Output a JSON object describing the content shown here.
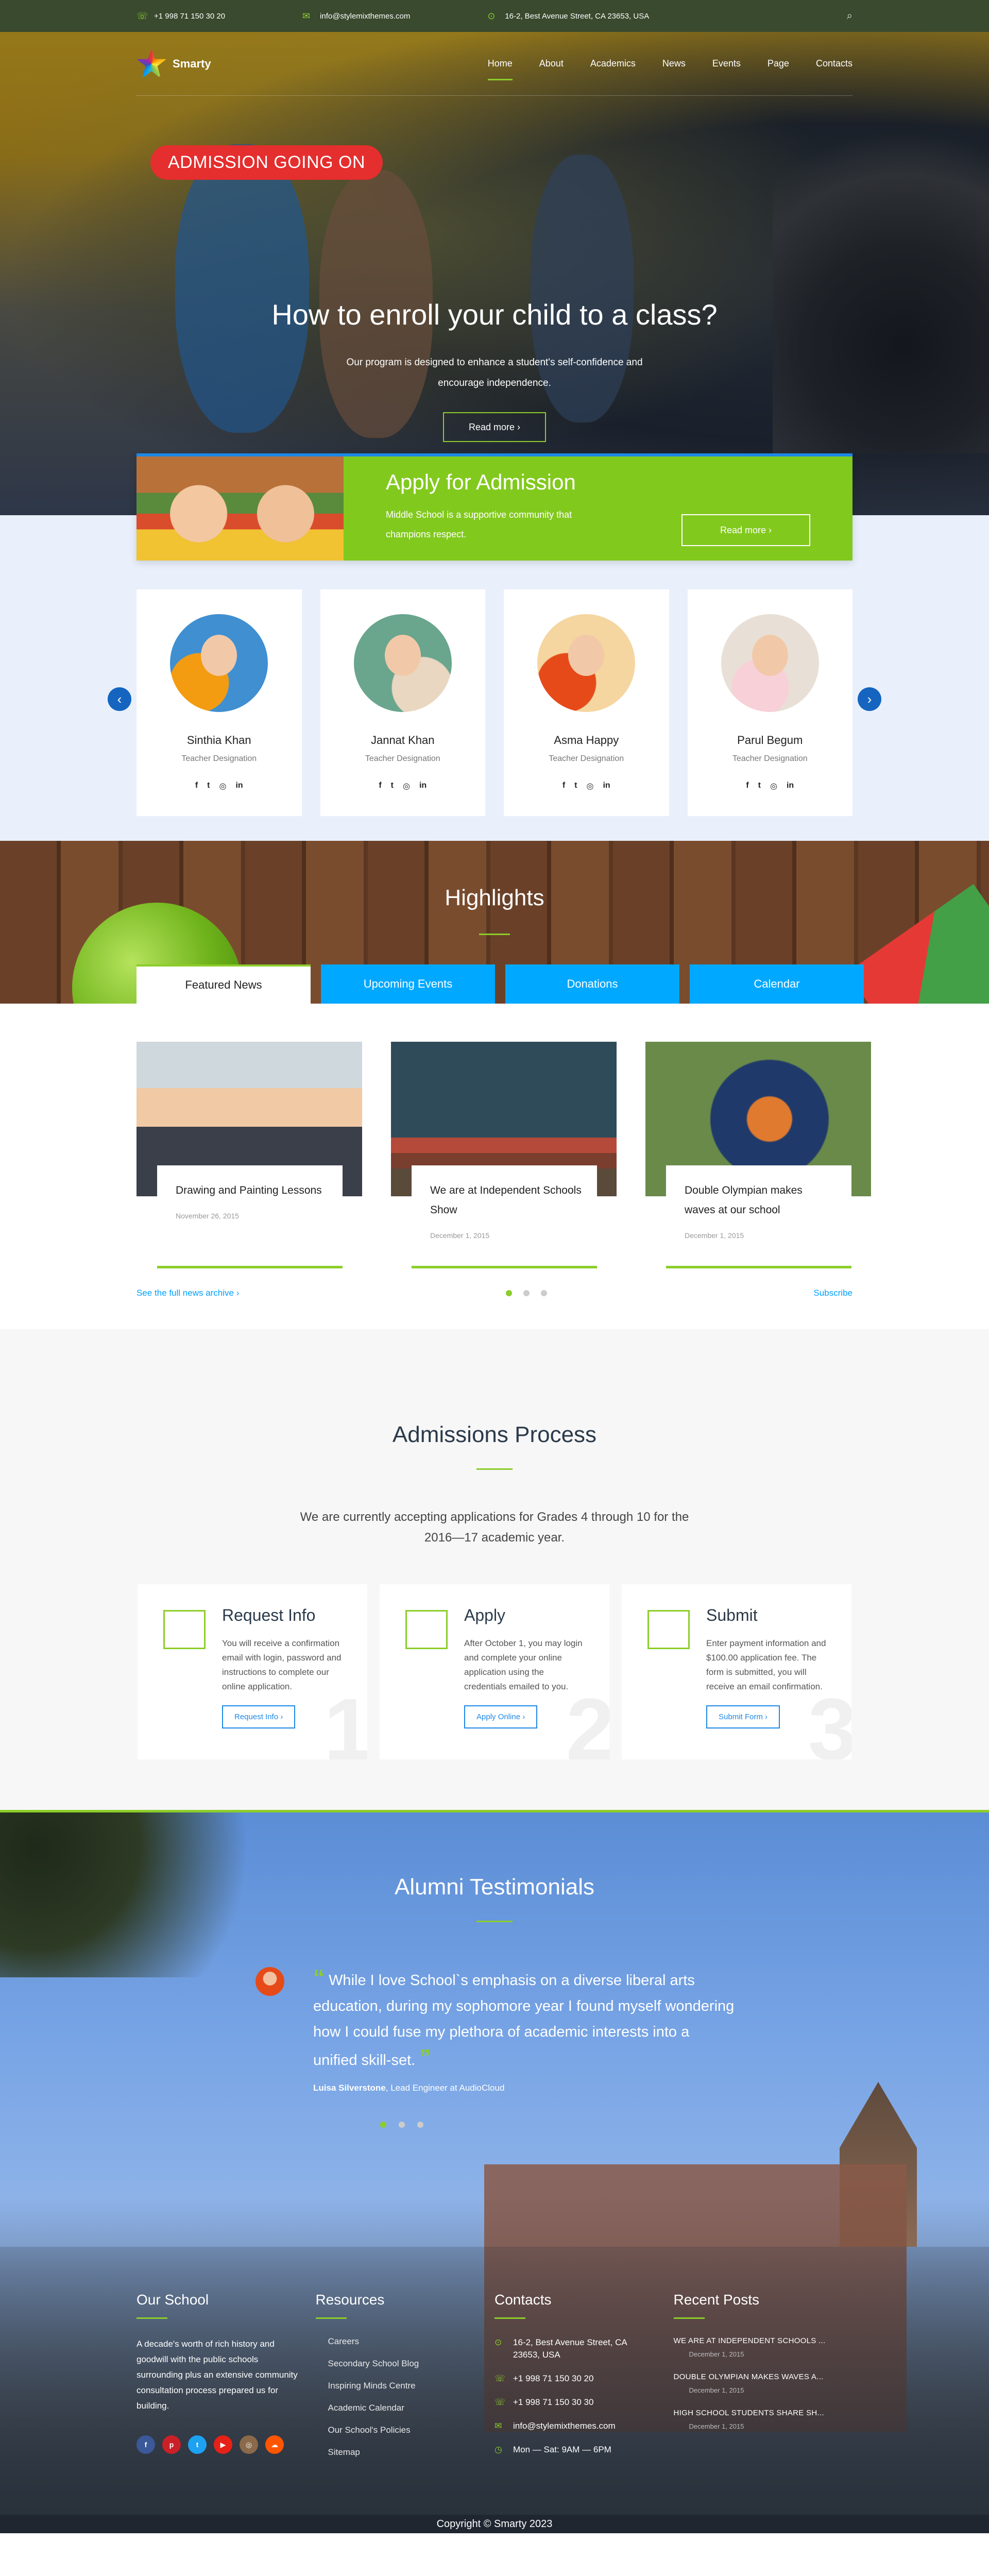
{
  "topbar": {
    "phone": "+1 998 71 150 30 20",
    "email": "info@stylemixthemes.com",
    "address": "16-2, Best Avenue Street, CA 23653, USA"
  },
  "nav": {
    "brand": "Smarty",
    "items": [
      "Home",
      "About",
      "Academics",
      "News",
      "Events",
      "Page",
      "Contacts"
    ]
  },
  "hero": {
    "badge": "ADMISSION GOING ON",
    "title": "How to enroll your child to a class?",
    "subtitle_line1": "Our program is designed to enhance a student's self-confidence and",
    "subtitle_line2": "encourage independence.",
    "button": "Read more ›"
  },
  "apply": {
    "title": "Apply for Admission",
    "text": "Middle School is a supportive community that champions respect.",
    "button": "Read more ›"
  },
  "teachers": [
    {
      "name": "Sinthia Khan",
      "designation": "Teacher Designation"
    },
    {
      "name": "Jannat Khan",
      "designation": "Teacher Designation"
    },
    {
      "name": "Asma Happy",
      "designation": "Teacher Designation"
    },
    {
      "name": "Parul Begum",
      "designation": "Teacher Designation"
    }
  ],
  "highlights": {
    "title": "Highlights",
    "tabs": [
      "Featured News",
      "Upcoming Events",
      "Donations",
      "Calendar"
    ],
    "news": [
      {
        "title": "Drawing and Painting Lessons",
        "date": "November 26, 2015"
      },
      {
        "title": "We are at Independent Schools Show",
        "date": "December 1, 2015"
      },
      {
        "title": "Double Olympian makes waves at our school",
        "date": "December 1, 2015"
      }
    ],
    "archive_link": "See the full news archive ›",
    "subscribe": "Subscribe"
  },
  "admissions": {
    "title": "Admissions Process",
    "intro": "We are currently accepting applications for Grades 4 through 10 for the 2016—17 academic year.",
    "steps": [
      {
        "title": "Request Info",
        "text": "You will receive a confirmation email with login, password and instructions to complete our online application.",
        "button": "Request Info ›",
        "num": "1"
      },
      {
        "title": "Apply",
        "text": "After October 1, you may login and complete your online application using the credentials emailed to you.",
        "button": "Apply Online ›",
        "num": "2"
      },
      {
        "title": "Submit",
        "text": "Enter payment information and $100.00 application fee. The form is submitted, you will receive an email confirmation.",
        "button": "Submit Form ›",
        "num": "3"
      }
    ]
  },
  "alumni": {
    "title": "Alumni Testimonials",
    "quote": "While I love School`s emphasis on a diverse liberal arts education, during my sophomore year I found myself wondering how I could fuse my plethora of academic interests into a unified skill-set.",
    "author": "Luisa Silverstone",
    "role": ", Lead Engineer at AudioCloud"
  },
  "footer": {
    "our_school_head": "Our School",
    "about": "A decade's worth of rich history and goodwill with the public schools surrounding plus an extensive community consultation process prepared us for building.",
    "resources_head": "Resources",
    "resources": [
      "Careers",
      "Secondary School Blog",
      "Inspiring Minds Centre",
      "Academic Calendar",
      "Our School's Policies",
      "Sitemap"
    ],
    "contacts_head": "Contacts",
    "contacts": {
      "address": "16-2, Best Avenue Street, CA 23653, USA",
      "phone1": "+1 998 71 150 30 20",
      "phone2": "+1 998 71 150 30 30",
      "email": "info@stylemixthemes.com",
      "hours": "Mon — Sat: 9AM — 6PM"
    },
    "posts_head": "Recent Posts",
    "posts": [
      {
        "title": "WE ARE AT INDEPENDENT SCHOOLS ...",
        "date": "December 1, 2015"
      },
      {
        "title": "DOUBLE OLYMPIAN MAKES WAVES A...",
        "date": "December 1, 2015"
      },
      {
        "title": "HIGH SCHOOL STUDENTS SHARE SH...",
        "date": "December 1, 2015"
      }
    ],
    "copyright": "Copyright © Smarty 2023"
  },
  "colors": {
    "accent": "#8ccd2a",
    "blue": "#00a8ff",
    "dark_blue": "#1565c0",
    "red": "#e52e2e"
  }
}
